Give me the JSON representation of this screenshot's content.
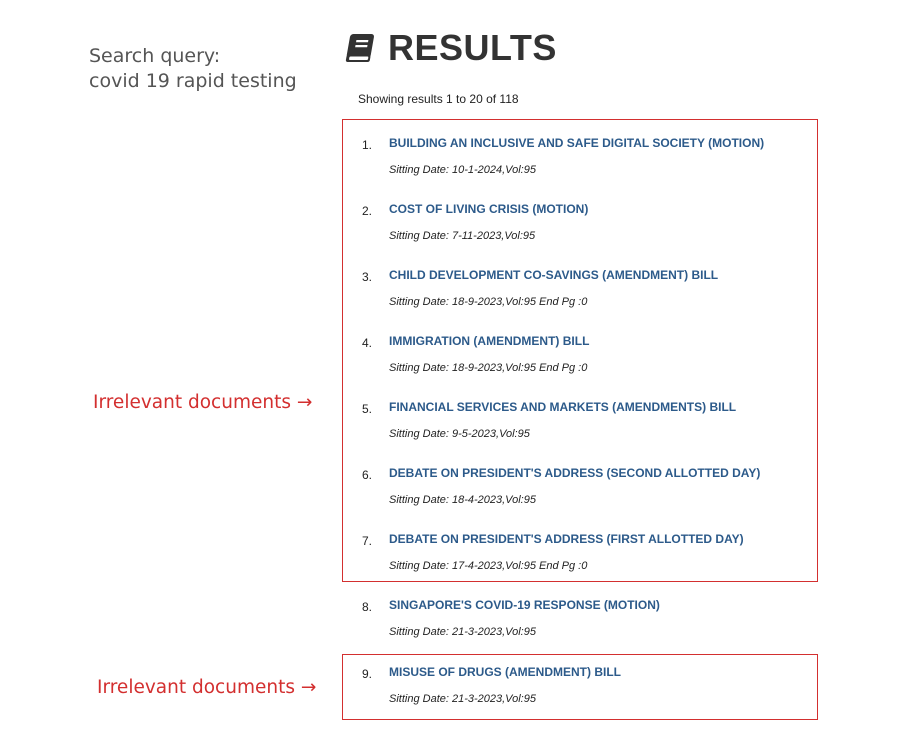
{
  "query": {
    "label": "Search query:",
    "text": "covid 19 rapid testing"
  },
  "header": {
    "icon": "book-icon",
    "title": "RESULTS",
    "count_text": "Showing results 1 to 20 of 118"
  },
  "results": [
    {
      "num": "1.",
      "title": "BUILDING AN INCLUSIVE AND SAFE DIGITAL SOCIETY (MOTION)",
      "meta": "Sitting Date: 10-1-2024,Vol:95"
    },
    {
      "num": "2.",
      "title": "COST OF LIVING CRISIS (MOTION)",
      "meta": "Sitting Date: 7-11-2023,Vol:95"
    },
    {
      "num": "3.",
      "title": "CHILD DEVELOPMENT CO-SAVINGS (AMENDMENT) BILL",
      "meta": "Sitting Date: 18-9-2023,Vol:95 End Pg :0"
    },
    {
      "num": "4.",
      "title": "IMMIGRATION (AMENDMENT) BILL",
      "meta": "Sitting Date: 18-9-2023,Vol:95 End Pg :0"
    },
    {
      "num": "5.",
      "title": "FINANCIAL SERVICES AND MARKETS (AMENDMENTS) BILL",
      "meta": "Sitting Date: 9-5-2023,Vol:95"
    },
    {
      "num": "6.",
      "title": "DEBATE ON PRESIDENT'S ADDRESS (SECOND ALLOTTED DAY)",
      "meta": "Sitting Date: 18-4-2023,Vol:95"
    },
    {
      "num": "7.",
      "title": "DEBATE ON PRESIDENT'S ADDRESS (FIRST ALLOTTED DAY)",
      "meta": "Sitting Date: 17-4-2023,Vol:95 End Pg :0"
    },
    {
      "num": "8.",
      "title": "SINGAPORE'S COVID-19 RESPONSE (MOTION)",
      "meta": "Sitting Date: 21-3-2023,Vol:95"
    },
    {
      "num": "9.",
      "title": "MISUSE OF DRUGS (AMENDMENT) BILL",
      "meta": "Sitting Date: 21-3-2023,Vol:95"
    }
  ],
  "annotations": [
    {
      "text": "Irrelevant documents →"
    },
    {
      "text": "Irrelevant documents →"
    }
  ],
  "colors": {
    "link": "#2c5a8a",
    "annotation": "#d32f2f",
    "heading": "#333333",
    "query": "#555555"
  }
}
